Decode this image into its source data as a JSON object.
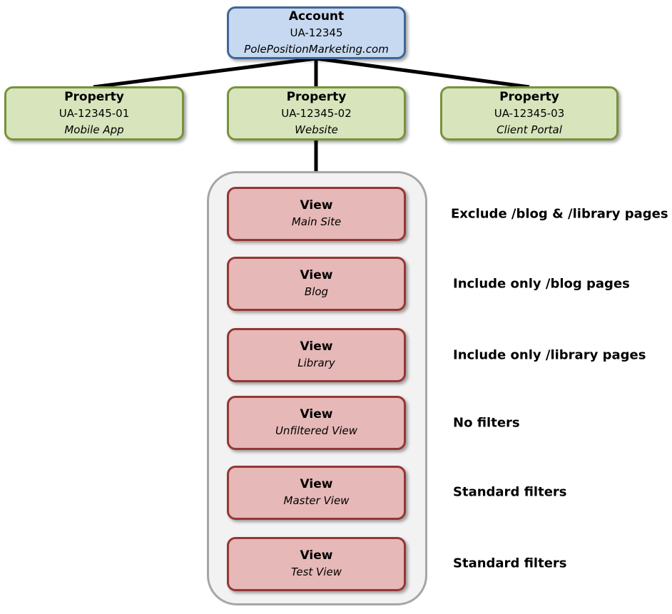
{
  "account": {
    "title": "Account",
    "id": "UA-12345",
    "name": "PolePositionMarketing.com"
  },
  "properties": [
    {
      "title": "Property",
      "id": "UA-12345-01",
      "name": "Mobile App"
    },
    {
      "title": "Property",
      "id": "UA-12345-02",
      "name": "Website"
    },
    {
      "title": "Property",
      "id": "UA-12345-03",
      "name": "Client Portal"
    }
  ],
  "views": [
    {
      "title": "View",
      "name": "Main Site",
      "filter": "Exclude /blog & /library pages"
    },
    {
      "title": "View",
      "name": "Blog",
      "filter": "Include only /blog pages"
    },
    {
      "title": "View",
      "name": "Library",
      "filter": "Include only /library pages"
    },
    {
      "title": "View",
      "name": "Unfiltered View",
      "filter": "No filters"
    },
    {
      "title": "View",
      "name": "Master View",
      "filter": "Standard filters"
    },
    {
      "title": "View",
      "name": "Test View",
      "filter": "Standard filters"
    }
  ],
  "colors": {
    "account": "#c6d9f0",
    "property": "#d8e4bc",
    "view": "#e6b8b7",
    "container": "#f2f2f2"
  }
}
